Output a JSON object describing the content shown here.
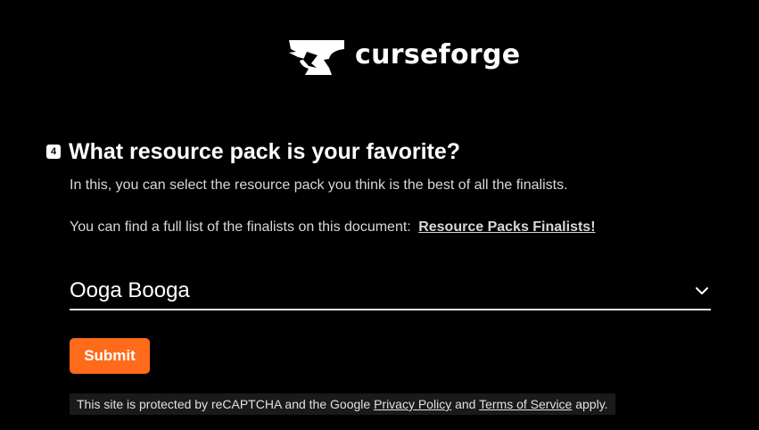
{
  "brand": {
    "name": "curseforge",
    "icon": "anvil-icon"
  },
  "question": {
    "number": "4",
    "title": "What resource pack is your favorite?",
    "description": "In this, you can select the resource pack you think is the best of all the finalists.",
    "link_intro": "You can find a full list of the finalists on this document:",
    "link_text": "Resource Packs Finalists!"
  },
  "select": {
    "value": "Ooga Booga",
    "icon": "chevron-down-icon"
  },
  "submit": {
    "label": "Submit"
  },
  "recaptcha": {
    "prefix": "This site is protected by reCAPTCHA and the Google",
    "privacy": "Privacy Policy",
    "and": "and",
    "terms": "Terms of Service",
    "suffix": "apply."
  },
  "colors": {
    "background": "#000000",
    "accent": "#ff6b1a",
    "text": "#ffffff"
  }
}
